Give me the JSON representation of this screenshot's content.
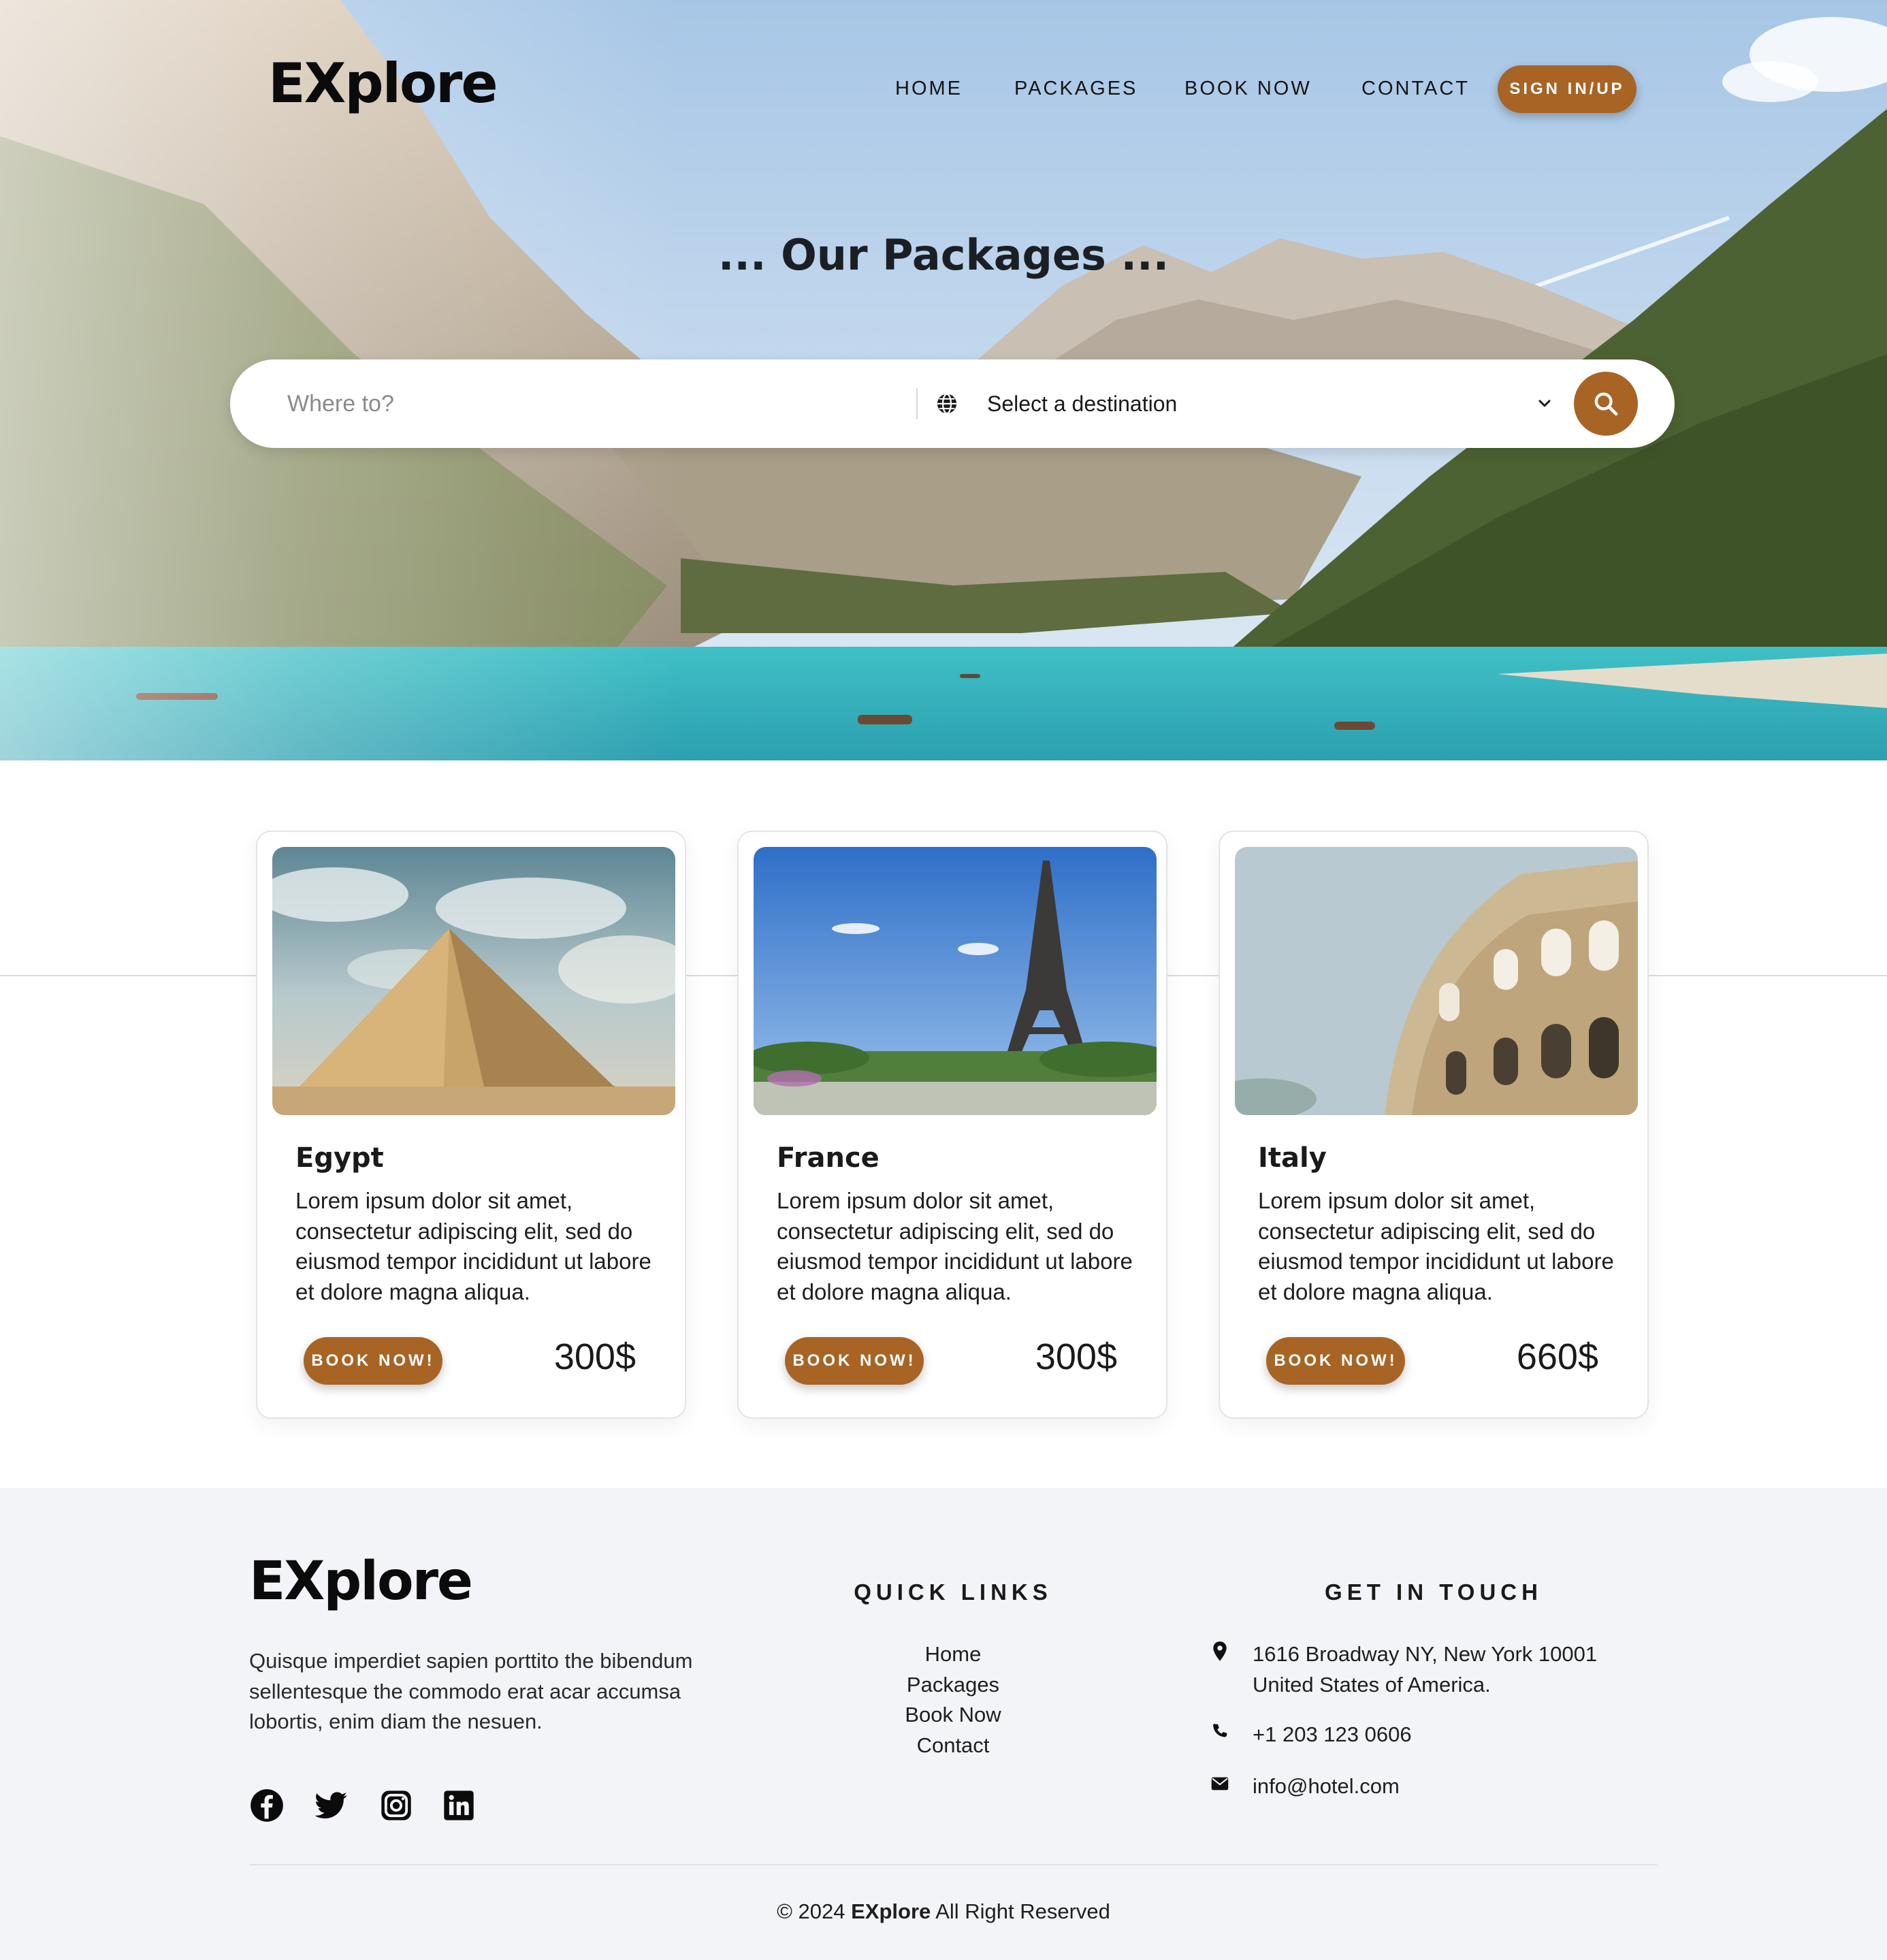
{
  "header": {
    "brand": "EXplore",
    "nav": [
      "HOME",
      "PACKAGES",
      "BOOK NOW",
      "CONTACT"
    ],
    "signin_label": "SIGN IN/UP"
  },
  "hero": {
    "title": "... Our Packages ...",
    "search": {
      "placeholder": "Where to?",
      "destination_selected": "Select a destination",
      "icons": [
        "globe-icon",
        "chevron-down-icon",
        "search-icon"
      ]
    }
  },
  "packages": [
    {
      "title": "Egypt",
      "description": "Lorem ipsum dolor sit amet, consectetur adipiscing elit, sed do eiusmod tempor incididunt ut labore et dolore magna aliqua.",
      "button": "BOOK NOW!",
      "price": "300$"
    },
    {
      "title": "France",
      "description": "Lorem ipsum dolor sit amet, consectetur adipiscing elit, sed do eiusmod tempor incididunt ut labore et dolore magna aliqua.",
      "button": "BOOK NOW!",
      "price": "300$"
    },
    {
      "title": "Italy",
      "description": "Lorem ipsum dolor sit amet, consectetur adipiscing elit, sed do eiusmod tempor incididunt ut labore et dolore magna aliqua.",
      "button": "BOOK NOW!",
      "price": "660$"
    }
  ],
  "footer": {
    "brand": "EXplore",
    "about": "Quisque imperdiet sapien porttito the bibendum sellentesque the commodo erat acar accumsa lobortis, enim diam the nesuen.",
    "social_icons": [
      "facebook-icon",
      "twitter-icon",
      "instagram-icon",
      "linkedin-icon"
    ],
    "quick_links_heading": "QUICK LINKS",
    "quick_links": [
      "Home",
      "Packages",
      "Book Now",
      "Contact"
    ],
    "contact_heading": "GET IN TOUCH",
    "address_line1": "1616 Broadway NY, New York 10001",
    "address_line2": "United States of America.",
    "phone": "+1 203 123 0606",
    "email": "info@hotel.com",
    "copyright_prefix": "© 2024",
    "copyright_brand": "EXplore",
    "copyright_suffix": "All Right Reserved"
  },
  "colors": {
    "accent": "#a86424",
    "footer_bg": "#f3f4f7",
    "text": "#1d1d1f"
  }
}
